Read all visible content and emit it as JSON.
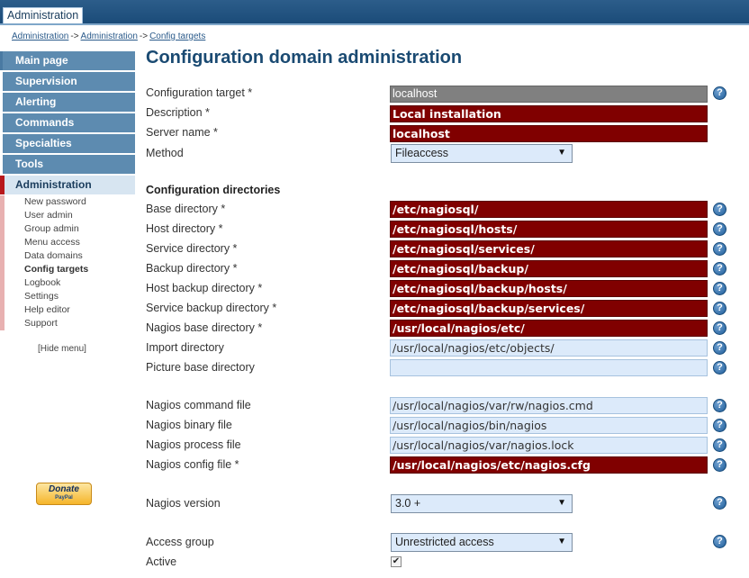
{
  "header": {
    "tab_label": "Administration"
  },
  "breadcrumb": {
    "items": [
      "Administration",
      "Administration",
      "Config targets"
    ],
    "separator": "->"
  },
  "sidebar": {
    "items": [
      {
        "label": "Main page"
      },
      {
        "label": "Supervision"
      },
      {
        "label": "Alerting"
      },
      {
        "label": "Commands"
      },
      {
        "label": "Specialties"
      },
      {
        "label": "Tools"
      },
      {
        "label": "Administration"
      }
    ],
    "submenu": [
      {
        "label": "New password"
      },
      {
        "label": "User admin"
      },
      {
        "label": "Group admin"
      },
      {
        "label": "Menu access"
      },
      {
        "label": "Data domains"
      },
      {
        "label": "Config targets"
      },
      {
        "label": "Logbook"
      },
      {
        "label": "Settings"
      },
      {
        "label": "Help editor"
      },
      {
        "label": "Support"
      }
    ],
    "hide_menu": "[Hide menu]"
  },
  "donate": {
    "label": "Donate",
    "sublabel": "PayPal"
  },
  "main": {
    "title": "Configuration domain administration",
    "section_directories": "Configuration directories",
    "help_glyph": "?",
    "fields": {
      "config_target": {
        "label": "Configuration target *",
        "value": "localhost"
      },
      "description": {
        "label": "Description *",
        "value": "Local installation"
      },
      "server_name": {
        "label": "Server name *",
        "value": "localhost"
      },
      "method": {
        "label": "Method",
        "value": "Fileaccess"
      },
      "base_dir": {
        "label": "Base directory *",
        "value": "/etc/nagiosql/"
      },
      "host_dir": {
        "label": "Host directory *",
        "value": "/etc/nagiosql/hosts/"
      },
      "service_dir": {
        "label": "Service directory *",
        "value": "/etc/nagiosql/services/"
      },
      "backup_dir": {
        "label": "Backup directory *",
        "value": "/etc/nagiosql/backup/"
      },
      "host_backup_dir": {
        "label": "Host backup directory *",
        "value": "/etc/nagiosql/backup/hosts/"
      },
      "service_backup_dir": {
        "label": "Service backup directory *",
        "value": "/etc/nagiosql/backup/services/"
      },
      "nagios_base_dir": {
        "label": "Nagios base directory *",
        "value": "/usr/local/nagios/etc/"
      },
      "import_dir": {
        "label": "Import directory",
        "value": "/usr/local/nagios/etc/objects/"
      },
      "picture_base_dir": {
        "label": "Picture base directory",
        "value": ""
      },
      "nagios_command_file": {
        "label": "Nagios command file",
        "value": "/usr/local/nagios/var/rw/nagios.cmd"
      },
      "nagios_binary_file": {
        "label": "Nagios binary file",
        "value": "/usr/local/nagios/bin/nagios"
      },
      "nagios_process_file": {
        "label": "Nagios process file",
        "value": "/usr/local/nagios/var/nagios.lock"
      },
      "nagios_config_file": {
        "label": "Nagios config file *",
        "value": "/usr/local/nagios/etc/nagios.cfg"
      },
      "nagios_version": {
        "label": "Nagios version",
        "value": "3.0 +"
      },
      "access_group": {
        "label": "Access group",
        "value": "Unrestricted access"
      },
      "active": {
        "label": "Active",
        "checked": true
      }
    }
  },
  "colors": {
    "header": "#1a4b78",
    "menu": "#5d8bb0",
    "required_field": "#800000",
    "optional_field": "#dceafa",
    "title": "#1a4a72"
  }
}
